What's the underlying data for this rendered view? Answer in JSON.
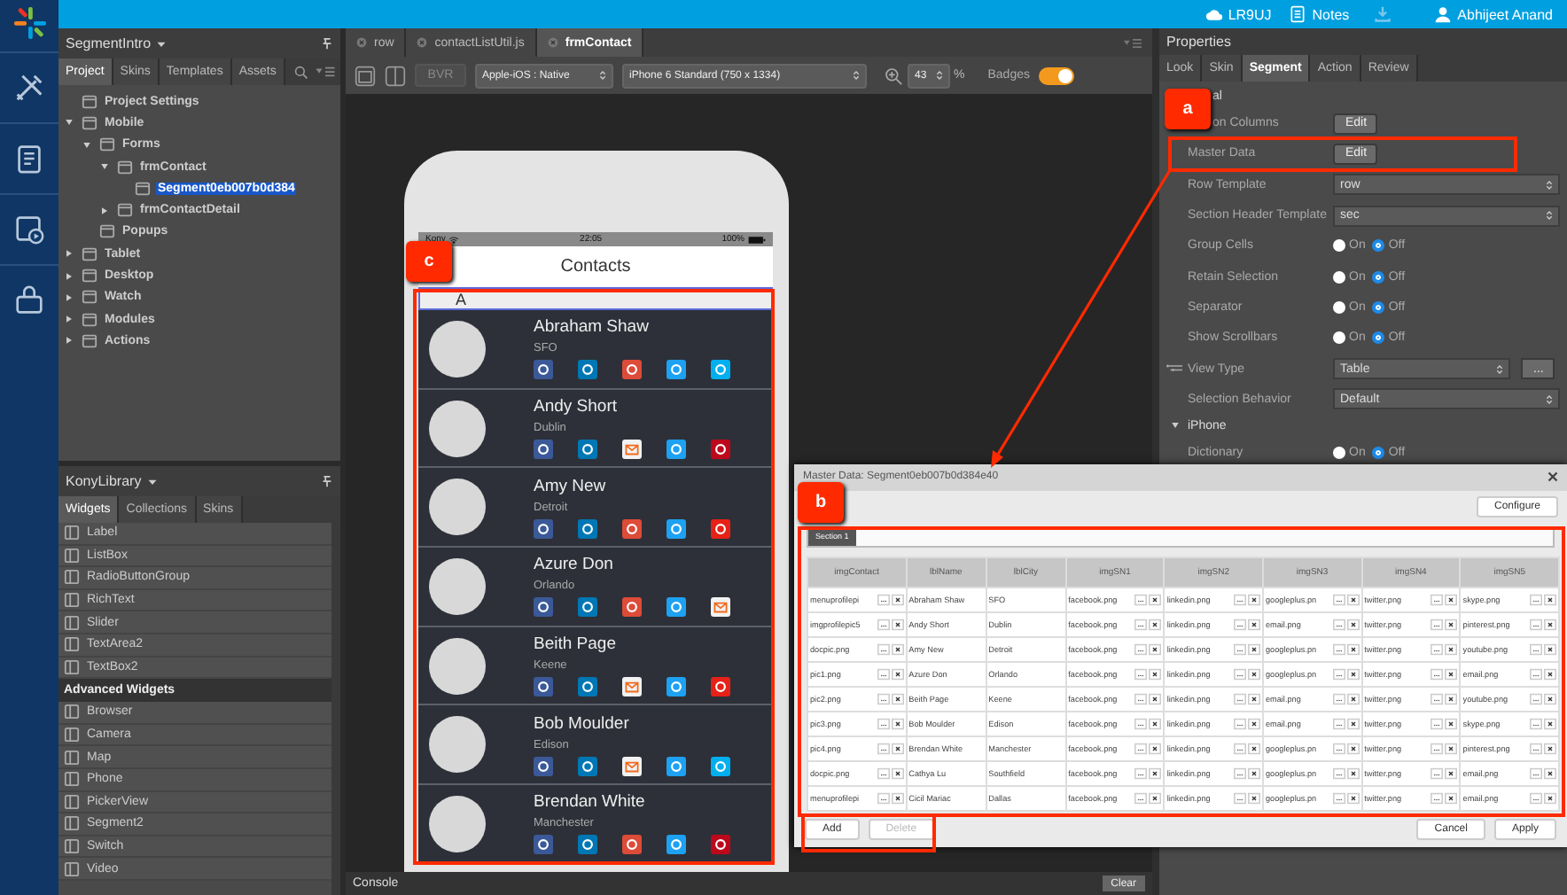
{
  "topbar": {
    "items": [
      {
        "kind": "cloud",
        "label": "LR9UJ",
        "disabled": false
      },
      {
        "kind": "notes",
        "label": "Notes",
        "disabled": false
      },
      {
        "kind": "download",
        "disabled": true
      },
      {
        "kind": "user",
        "label": "Abhijeet Anand",
        "disabled": false
      }
    ]
  },
  "project_panel": {
    "title": "SegmentIntro",
    "tabs": [
      {
        "label": "Project",
        "selected": true
      },
      {
        "label": "Skins",
        "selected": false
      },
      {
        "label": "Templates",
        "selected": false
      },
      {
        "label": "Assets",
        "selected": false
      }
    ],
    "tree": [
      {
        "label": "Project Settings",
        "selected": false
      },
      {
        "label": "Mobile",
        "selected": false,
        "expanded": true,
        "children": [
          {
            "label": "Forms",
            "selected": false,
            "expanded": true,
            "children": [
              {
                "label": "frmContact",
                "selected": false,
                "expanded": true,
                "children": [
                  {
                    "label": "Segment0eb007b0d384",
                    "selected": true
                  }
                ]
              },
              {
                "label": "frmContactDetail",
                "selected": false,
                "expanded": false
              }
            ]
          },
          {
            "label": "Popups",
            "selected": false
          }
        ]
      },
      {
        "label": "Tablet",
        "selected": false,
        "expanded": false
      },
      {
        "label": "Desktop",
        "selected": false,
        "expanded": false
      },
      {
        "label": "Watch",
        "selected": false,
        "expanded": false
      },
      {
        "label": "Modules",
        "selected": false,
        "expanded": false
      },
      {
        "label": "Actions",
        "selected": false,
        "expanded": false
      }
    ]
  },
  "library_panel": {
    "title": "KonyLibrary",
    "tabs": [
      {
        "label": "Widgets",
        "selected": true
      },
      {
        "label": "Collections",
        "selected": false
      },
      {
        "label": "Skins",
        "selected": false
      }
    ],
    "items": [
      {
        "kind": "widget",
        "label": "Label"
      },
      {
        "kind": "widget",
        "label": "ListBox"
      },
      {
        "kind": "widget",
        "label": "RadioButtonGroup"
      },
      {
        "kind": "widget",
        "label": "RichText"
      },
      {
        "kind": "widget",
        "label": "Slider"
      },
      {
        "kind": "widget",
        "label": "TextArea2"
      },
      {
        "kind": "widget",
        "label": "TextBox2"
      },
      {
        "kind": "group",
        "label": "Advanced Widgets"
      },
      {
        "kind": "widget",
        "label": "Browser"
      },
      {
        "kind": "widget",
        "label": "Camera"
      },
      {
        "kind": "widget",
        "label": "Map"
      },
      {
        "kind": "widget",
        "label": "Phone"
      },
      {
        "kind": "widget",
        "label": "PickerView"
      },
      {
        "kind": "widget",
        "label": "Segment2"
      },
      {
        "kind": "widget",
        "label": "Switch"
      },
      {
        "kind": "widget",
        "label": "Video"
      }
    ]
  },
  "editor": {
    "tabs": [
      {
        "label": "row",
        "selected": false
      },
      {
        "label": "contactListUtil.js",
        "selected": false
      },
      {
        "label": "frmContact",
        "selected": true
      }
    ],
    "toolbar": {
      "bvr": {
        "label": "BVR",
        "disabled": true
      },
      "platform": "Apple-iOS : Native",
      "device": "iPhone 6 Standard (750 x 1334)",
      "zoom": "43",
      "zoom_unit": "%",
      "badges": {
        "label": "Badges",
        "on": true
      }
    },
    "console": {
      "title": "Console",
      "clear": "Clear"
    }
  },
  "phone": {
    "status": {
      "carrier": "Kony",
      "time": "22:05",
      "battery": "100%"
    },
    "title": "Contacts",
    "section_header": "A",
    "contacts": [
      {
        "name": "Abraham Shaw",
        "city": "SFO",
        "icons": [
          {
            "kind": "facebook"
          },
          {
            "kind": "linkedin"
          },
          {
            "kind": "googleplus"
          },
          {
            "kind": "twitter"
          },
          {
            "kind": "skype"
          }
        ]
      },
      {
        "name": "Andy Short",
        "city": "Dublin",
        "icons": [
          {
            "kind": "facebook"
          },
          {
            "kind": "linkedin"
          },
          {
            "kind": "email"
          },
          {
            "kind": "twitter"
          },
          {
            "kind": "pinterest"
          }
        ]
      },
      {
        "name": "Amy New",
        "city": "Detroit",
        "icons": [
          {
            "kind": "facebook"
          },
          {
            "kind": "linkedin"
          },
          {
            "kind": "googleplus"
          },
          {
            "kind": "twitter"
          },
          {
            "kind": "youtube"
          }
        ]
      },
      {
        "name": "Azure Don",
        "city": "Orlando",
        "icons": [
          {
            "kind": "facebook"
          },
          {
            "kind": "linkedin"
          },
          {
            "kind": "googleplus"
          },
          {
            "kind": "twitter"
          },
          {
            "kind": "email"
          }
        ]
      },
      {
        "name": "Beith Page",
        "city": "Keene",
        "icons": [
          {
            "kind": "facebook"
          },
          {
            "kind": "linkedin"
          },
          {
            "kind": "email"
          },
          {
            "kind": "twitter"
          },
          {
            "kind": "youtube"
          }
        ]
      },
      {
        "name": "Bob Moulder",
        "city": "Edison",
        "icons": [
          {
            "kind": "facebook"
          },
          {
            "kind": "linkedin"
          },
          {
            "kind": "email"
          },
          {
            "kind": "twitter"
          },
          {
            "kind": "skype"
          }
        ]
      },
      {
        "name": "Brendan White",
        "city": "Manchester",
        "icons": [
          {
            "kind": "facebook"
          },
          {
            "kind": "linkedin"
          },
          {
            "kind": "googleplus"
          },
          {
            "kind": "twitter"
          },
          {
            "kind": "pinterest"
          }
        ]
      }
    ]
  },
  "properties": {
    "title": "Properties",
    "tabs": [
      {
        "label": "Look",
        "selected": false
      },
      {
        "label": "Skin",
        "selected": false
      },
      {
        "label": "Segment",
        "selected": true
      },
      {
        "label": "Action",
        "selected": false
      },
      {
        "label": "Review",
        "selected": false
      }
    ],
    "rows": [
      {
        "kind": "header",
        "label": "al"
      },
      {
        "kind": "button",
        "label": "on Columns",
        "button": "Edit"
      },
      {
        "kind": "button",
        "label": "Master Data",
        "button": "Edit"
      },
      {
        "kind": "select",
        "label": "Row Template",
        "value": "row"
      },
      {
        "kind": "select",
        "label": "Section Header Template",
        "value": "sec"
      },
      {
        "kind": "radio",
        "label": "Group Cells",
        "options": [
          {
            "label": "On",
            "selected": false
          },
          {
            "label": "Off",
            "selected": true
          }
        ]
      },
      {
        "kind": "radio",
        "label": "Retain Selection",
        "options": [
          {
            "label": "On",
            "selected": false
          },
          {
            "label": "Off",
            "selected": true
          }
        ]
      },
      {
        "kind": "radio",
        "label": "Separator",
        "options": [
          {
            "label": "On",
            "selected": false
          },
          {
            "label": "Off",
            "selected": true
          }
        ]
      },
      {
        "kind": "radio",
        "label": "Show Scrollbars",
        "options": [
          {
            "label": "On",
            "selected": false
          },
          {
            "label": "Off",
            "selected": true
          }
        ]
      },
      {
        "kind": "select-more",
        "label": "View Type",
        "value": "Table",
        "more": "..."
      },
      {
        "kind": "select",
        "label": "Selection Behavior",
        "value": "Default"
      },
      {
        "kind": "header",
        "label": "iPhone",
        "expanded": true
      },
      {
        "kind": "radio",
        "label": "Dictionary",
        "options": [
          {
            "label": "On",
            "selected": false
          },
          {
            "label": "Off",
            "selected": true
          }
        ]
      }
    ]
  },
  "dialog": {
    "title": "Master Data: Segment0eb007b0d384e40",
    "configure": "Configure",
    "section_tab": "Section 1",
    "columns": [
      {
        "label": "imgContact",
        "kind": "image"
      },
      {
        "label": "lblName",
        "kind": "text"
      },
      {
        "label": "lblCity",
        "kind": "text"
      },
      {
        "label": "imgSN1",
        "kind": "image"
      },
      {
        "label": "imgSN2",
        "kind": "image"
      },
      {
        "label": "imgSN3",
        "kind": "image"
      },
      {
        "label": "imgSN4",
        "kind": "image"
      },
      {
        "label": "imgSN5",
        "kind": "image"
      }
    ],
    "rows": [
      [
        "menuprofilepi",
        "Abraham Shaw",
        "SFO",
        "facebook.png",
        "linkedin.png",
        "googleplus.pn",
        "twitter.png",
        "skype.png"
      ],
      [
        "imgprofilepic5",
        "Andy Short",
        "Dublin",
        "facebook.png",
        "linkedin.png",
        "email.png",
        "twitter.png",
        "pinterest.png"
      ],
      [
        "docpic.png",
        "Amy New",
        "Detroit",
        "facebook.png",
        "linkedin.png",
        "googleplus.pn",
        "twitter.png",
        "youtube.png"
      ],
      [
        "pic1.png",
        "Azure Don",
        "Orlando",
        "facebook.png",
        "linkedin.png",
        "googleplus.pn",
        "twitter.png",
        "email.png"
      ],
      [
        "pic2.png",
        "Beith Page",
        "Keene",
        "facebook.png",
        "linkedin.png",
        "email.png",
        "twitter.png",
        "youtube.png"
      ],
      [
        "pic3.png",
        "Bob Moulder",
        "Edison",
        "facebook.png",
        "linkedin.png",
        "email.png",
        "twitter.png",
        "skype.png"
      ],
      [
        "pic4.png",
        "Brendan White",
        "Manchester",
        "facebook.png",
        "linkedin.png",
        "googleplus.pn",
        "twitter.png",
        "pinterest.png"
      ],
      [
        "docpic.png",
        "Cathya Lu",
        "Southfield",
        "facebook.png",
        "linkedin.png",
        "googleplus.pn",
        "twitter.png",
        "email.png"
      ],
      [
        "menuprofilepi",
        "Cicil Mariac",
        "Dallas",
        "facebook.png",
        "linkedin.png",
        "googleplus.pn",
        "twitter.png",
        "email.png"
      ]
    ],
    "buttons": [
      {
        "label": "Add",
        "disabled": false
      },
      {
        "label": "Delete",
        "disabled": true
      }
    ],
    "actions": [
      "Cancel",
      "Apply"
    ]
  },
  "callouts": [
    {
      "label": "a"
    },
    {
      "label": "b"
    },
    {
      "label": "c"
    }
  ]
}
